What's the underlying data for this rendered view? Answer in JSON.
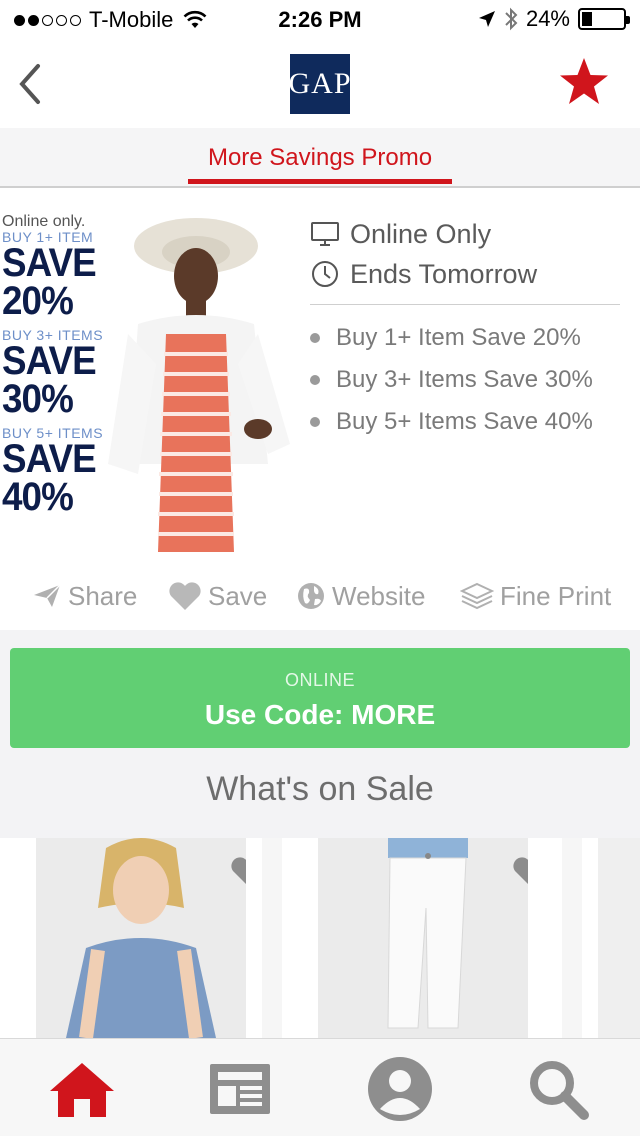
{
  "status_bar": {
    "carrier": "T-Mobile",
    "time": "2:26 PM",
    "battery": "24%",
    "battery_level": 0.24,
    "signal_dots_filled": 2,
    "signal_dots_total": 5
  },
  "nav": {
    "logo_text": "GAP",
    "back_icon": "chevron-left-icon",
    "favorite_icon": "star-icon",
    "accent_color": "#d0151c"
  },
  "tab": {
    "label": "More Savings Promo"
  },
  "ad": {
    "online_only": "Online only.",
    "tier1_label": "BUY 1+ ITEM",
    "tier1_save": "SAVE",
    "tier1_pct": "20%",
    "tier2_label": "BUY 3+ ITEMS",
    "tier2_save": "SAVE",
    "tier2_pct": "30%",
    "tier3_label": "BUY 5+ ITEMS",
    "tier3_save": "SAVE",
    "tier3_pct": "40%"
  },
  "promo": {
    "channel": "Online Only",
    "expires": "Ends Tomorrow",
    "details": [
      "Buy 1+ Item Save 20%",
      "Buy 3+ Items Save 30%",
      "Buy 5+ Items Save 40%"
    ]
  },
  "actions": {
    "share": "Share",
    "save": "Save",
    "website": "Website",
    "fine_print": "Fine Print"
  },
  "code": {
    "type": "ONLINE",
    "label": "Use Code: MORE",
    "color": "#61cf73"
  },
  "sale_section": {
    "title": "What's on Sale"
  },
  "bottom_nav": {
    "items": [
      "home-icon",
      "news-icon",
      "profile-icon",
      "search-icon"
    ],
    "active_color": "#d0151c"
  }
}
